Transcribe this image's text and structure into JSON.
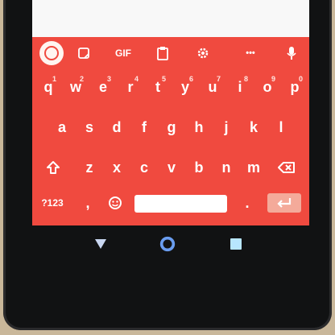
{
  "colors": {
    "keyboard_bg": "#f04a3f",
    "key_text": "#ffffff",
    "hint_text": "#ffe5e0",
    "enter_bg": "#f4aa9a",
    "nav_bar_bg": "#111213",
    "screen_bg": "#ffffff"
  },
  "toolbar": {
    "g_icon": "google-g-icon",
    "sticker_icon": "sticker-icon",
    "gif_label": "GIF",
    "clipboard_icon": "clipboard-icon",
    "settings_icon": "gear-icon",
    "more_label": "•••",
    "mic_icon": "microphone-icon"
  },
  "rows": {
    "row1": [
      {
        "label": "q",
        "hint": "1"
      },
      {
        "label": "w",
        "hint": "2"
      },
      {
        "label": "e",
        "hint": "3"
      },
      {
        "label": "r",
        "hint": "4"
      },
      {
        "label": "t",
        "hint": "5"
      },
      {
        "label": "y",
        "hint": "6"
      },
      {
        "label": "u",
        "hint": "7"
      },
      {
        "label": "i",
        "hint": "8"
      },
      {
        "label": "o",
        "hint": "9"
      },
      {
        "label": "p",
        "hint": "0"
      }
    ],
    "row2": [
      {
        "label": "a"
      },
      {
        "label": "s"
      },
      {
        "label": "d"
      },
      {
        "label": "f"
      },
      {
        "label": "g"
      },
      {
        "label": "h"
      },
      {
        "label": "j"
      },
      {
        "label": "k"
      },
      {
        "label": "l"
      }
    ],
    "row3": [
      {
        "label": "z"
      },
      {
        "label": "x"
      },
      {
        "label": "c"
      },
      {
        "label": "v"
      },
      {
        "label": "b"
      },
      {
        "label": "n"
      },
      {
        "label": "m"
      }
    ]
  },
  "row4": {
    "symbols_label": "?123",
    "comma_label": ",",
    "emoji_icon": "emoji-icon",
    "spacebar_label": "",
    "period_label": ".",
    "enter_icon": "enter-arrow-icon"
  },
  "navbar": {
    "back_icon": "back-triangle-icon",
    "home_icon": "home-circle-icon",
    "recents_icon": "recents-square-icon"
  }
}
